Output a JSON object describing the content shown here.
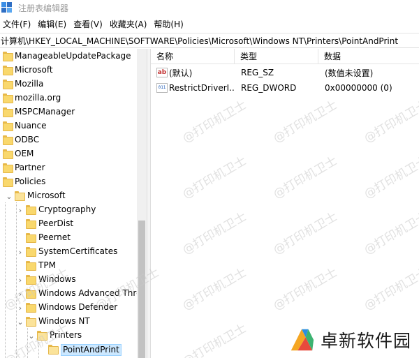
{
  "window": {
    "title": "注册表编辑器"
  },
  "menu": [
    "文件(F)",
    "编辑(E)",
    "查看(V)",
    "收藏夹(A)",
    "帮助(H)"
  ],
  "address": "计算机\\HKEY_LOCAL_MACHINE\\SOFTWARE\\Policies\\Microsoft\\Windows NT\\Printers\\PointAndPrint",
  "tree": [
    {
      "label": "ManageableUpdatePackage",
      "level": 0,
      "expander": ""
    },
    {
      "label": "Microsoft",
      "level": 0,
      "expander": ""
    },
    {
      "label": "Mozilla",
      "level": 0,
      "expander": ""
    },
    {
      "label": "mozilla.org",
      "level": 0,
      "expander": ""
    },
    {
      "label": "MSPCManager",
      "level": 0,
      "expander": ""
    },
    {
      "label": "Nuance",
      "level": 0,
      "expander": ""
    },
    {
      "label": "ODBC",
      "level": 0,
      "expander": ""
    },
    {
      "label": "OEM",
      "level": 0,
      "expander": ""
    },
    {
      "label": "Partner",
      "level": 0,
      "expander": ""
    },
    {
      "label": "Policies",
      "level": 0,
      "expander": ""
    },
    {
      "label": "Microsoft",
      "level": 1,
      "expander": "open"
    },
    {
      "label": "Cryptography",
      "level": 2,
      "expander": "closed"
    },
    {
      "label": "PeerDist",
      "level": 2,
      "expander": ""
    },
    {
      "label": "Peernet",
      "level": 2,
      "expander": ""
    },
    {
      "label": "SystemCertificates",
      "level": 2,
      "expander": "closed"
    },
    {
      "label": "TPM",
      "level": 2,
      "expander": ""
    },
    {
      "label": "Windows",
      "level": 2,
      "expander": "closed"
    },
    {
      "label": "Windows Advanced Threat",
      "level": 2,
      "expander": "closed"
    },
    {
      "label": "Windows Defender",
      "level": 2,
      "expander": "closed"
    },
    {
      "label": "Windows NT",
      "level": 2,
      "expander": "open"
    },
    {
      "label": "Printers",
      "level": 3,
      "expander": "open"
    },
    {
      "label": "PointAndPrint",
      "level": 4,
      "expander": "",
      "selected": true
    }
  ],
  "list": {
    "headers": {
      "name": "名称",
      "type": "类型",
      "data": "数据"
    },
    "rows": [
      {
        "icon": "string-value-icon",
        "icon_text": "ab",
        "name": "(默认)",
        "type": "REG_SZ",
        "data": "(数值未设置)"
      },
      {
        "icon": "binary-value-icon",
        "icon_text": "011",
        "name": "RestrictDriverI...",
        "type": "REG_DWORD",
        "data": "0x00000000 (0)"
      }
    ]
  },
  "watermark": "@打印机卫士",
  "brand": {
    "text": "卓新软件园",
    "colors": [
      "#f5a623",
      "#e84a3c",
      "#2c8fe0",
      "#3cb371"
    ]
  }
}
